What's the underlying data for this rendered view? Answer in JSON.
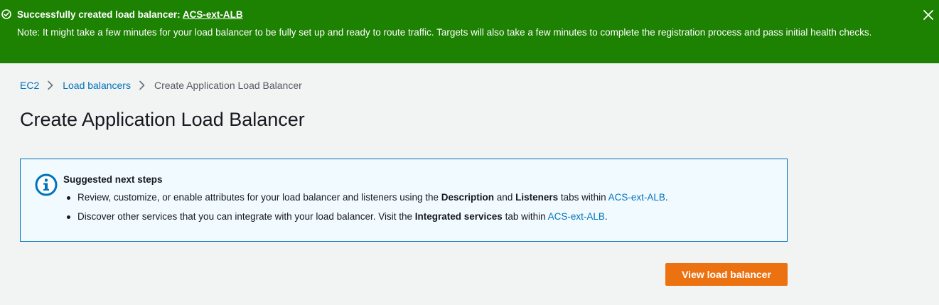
{
  "banner": {
    "title_prefix": "Successfully created load balancer: ",
    "title_link": "ACS-ext-ALB",
    "note": "Note: It might take a few minutes for your load balancer to be fully set up and ready to route traffic. Targets will also take a few minutes to complete the registration process and pass initial health checks.",
    "icons": {
      "status": "check-circle-icon",
      "close": "close-icon"
    },
    "background_color": "#1d8102"
  },
  "breadcrumb": {
    "items": [
      "EC2",
      "Load balancers"
    ],
    "current": "Create Application Load Balancer"
  },
  "page_title": "Create Application Load Balancer",
  "info_box": {
    "heading": "Suggested next steps",
    "icon": "info-icon",
    "items": [
      {
        "t1": "Review, customize, or enable attributes for your load balancer and listeners using the ",
        "b1": "Description",
        "t2": " and ",
        "b2": "Listeners",
        "t3": " tabs within ",
        "link": "ACS-ext-ALB",
        "t4": "."
      },
      {
        "t1": "Discover other services that you can integrate with your load balancer. Visit the ",
        "b1": "Integrated services",
        "t3": " tab within ",
        "link": "ACS-ext-ALB",
        "t4": "."
      }
    ]
  },
  "actions": {
    "view_load_balancer": "View load balancer"
  },
  "colors": {
    "accent_link": "#0073bb",
    "primary_button": "#ec7211"
  }
}
